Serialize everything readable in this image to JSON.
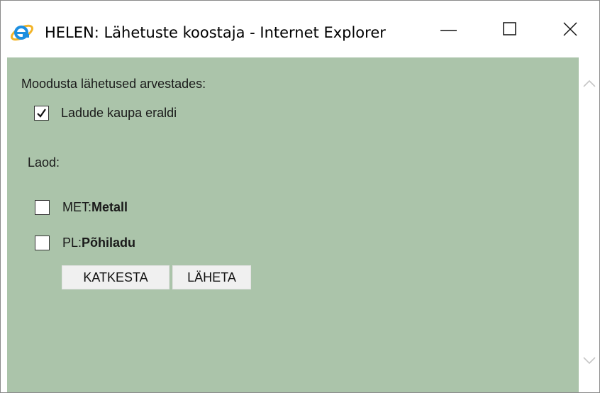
{
  "window": {
    "title": "HELEN: Lähetuste koostaja - Internet Explorer",
    "icon": "internet-explorer-icon",
    "controls": [
      "minimize-icon",
      "maximize-icon",
      "close-icon"
    ]
  },
  "form": {
    "heading": "Moodusta lähetused arvestades:",
    "split_by_warehouse": {
      "label": "Ladude kaupa eraldi",
      "checked": true
    },
    "warehouses_label": "Laod:",
    "warehouses": [
      {
        "code": "MET:",
        "name": "Metall",
        "checked": false
      },
      {
        "code": "PL:",
        "name": "Põhiladu",
        "checked": false
      }
    ],
    "buttons": {
      "cancel": "KATKESTA",
      "send": "LÄHETA"
    }
  },
  "colors": {
    "content_background": "#abc4aa",
    "ie_blue": "#1e8fe0",
    "ie_ring": "#f2b428"
  }
}
